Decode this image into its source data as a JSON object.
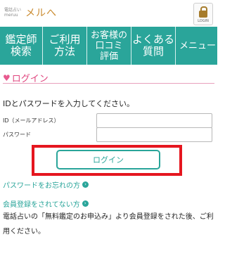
{
  "header": {
    "logo_small": "電話占い meruu",
    "logo_main": "メルへ",
    "login_label": "LOGIN"
  },
  "nav": {
    "items": [
      {
        "label": "鑑定師\n検索"
      },
      {
        "label": "ご利用\n方法"
      },
      {
        "label": "お客様の\n口コミ\n評価"
      },
      {
        "label": "よくある\n質問"
      },
      {
        "label": "メニュー"
      }
    ]
  },
  "login": {
    "section_title": "ログイン",
    "intro": "IDとパスワードを入力してください。",
    "id_label": "ID（メールアドレス）",
    "password_label": "パスワード",
    "id_value": "",
    "password_value": "",
    "button_label": "ログイン",
    "forgot_link": "パスワードをお忘れの方",
    "register_link": "会員登録をされてない方",
    "register_desc": "電話占いの「無料鑑定のお申込み」より会員登録をされた後、ご利用ください。"
  },
  "colors": {
    "accent": "#2aa59a",
    "pink": "#e0467f",
    "highlight": "#e5161f"
  }
}
